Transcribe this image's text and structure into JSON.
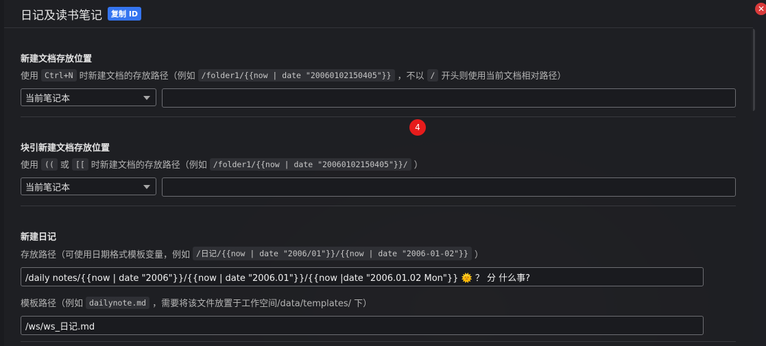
{
  "dialog": {
    "title": "日记及读书笔记",
    "id_badge": "复制 ID"
  },
  "badge_number": "4",
  "sec1": {
    "label": "新建文档存放位置",
    "desc_a": "使用",
    "code_a": "Ctrl+N",
    "desc_b": "时新建文档的存放路径（例如",
    "code_b": "/folder1/{{now | date \"20060102150405\"}}",
    "desc_c": "，不以",
    "code_c": "/",
    "desc_d": "开头则使用当前文档相对路径）",
    "select_value": "当前笔记本",
    "input_value": ""
  },
  "sec2": {
    "label": "块引新建文档存放位置",
    "desc_a": "使用",
    "code_a": "((",
    "desc_b": "或",
    "code_b": "[[",
    "desc_c": "时新建文档的存放路径（例如",
    "code_c": "/folder1/{{now | date \"20060102150405\"}}/",
    "desc_d": "）",
    "select_value": "当前笔记本",
    "input_value": ""
  },
  "sec3": {
    "label": "新建日记",
    "desc_a": "存放路径（可使用日期格式模板变量，例如",
    "code_a": "/日记/{{now | date \"2006/01\"}}/{{now | date \"2006-01-02\"}}",
    "desc_b": "）",
    "path_value": "/daily notes/{{now | date \"2006\"}}/{{now | date \"2006.01\"}}/{{now |date \"2006.01.02  Mon\"}} 🌞 ？ 分 什么事?",
    "template_desc_a": "模板路径（例如",
    "template_code": "dailynote.md",
    "template_desc_b": "，需要将该文件放置于工作空间/data/templates/ 下）",
    "template_value": "/ws/ws_日记.md"
  }
}
